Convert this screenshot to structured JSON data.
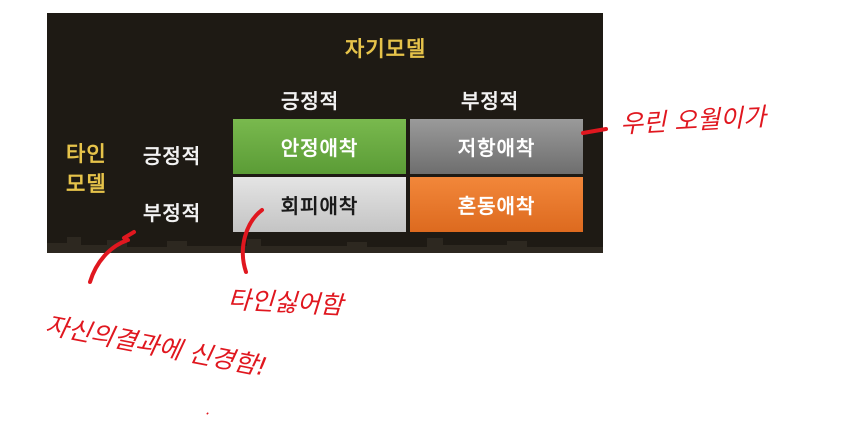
{
  "matrix": {
    "self_model_title": "자기모델",
    "other_model_title_line1": "타인",
    "other_model_title_line2": "모델",
    "columns": [
      "긍정적",
      "부정적"
    ],
    "rows": [
      "긍정적",
      "부정적"
    ],
    "cells": {
      "pos_pos": "안정애착",
      "pos_neg": "저항애착",
      "neg_pos": "회피애착",
      "neg_neg": "혼동애착"
    },
    "colors": {
      "panel_bg": "#1e1a14",
      "title_gold": "#e6c34a",
      "secure_green": "#5b9c36",
      "resist_gray": "#7a7a7a",
      "avoid_lightgray": "#d0d0d0",
      "chaos_orange": "#e8742a"
    }
  },
  "annotations": {
    "ink_color": "#e0171f",
    "note_right": "우린 오월이가",
    "note_middle": "타인싫어함",
    "note_bottom": "자신의결과에 신경함!"
  }
}
